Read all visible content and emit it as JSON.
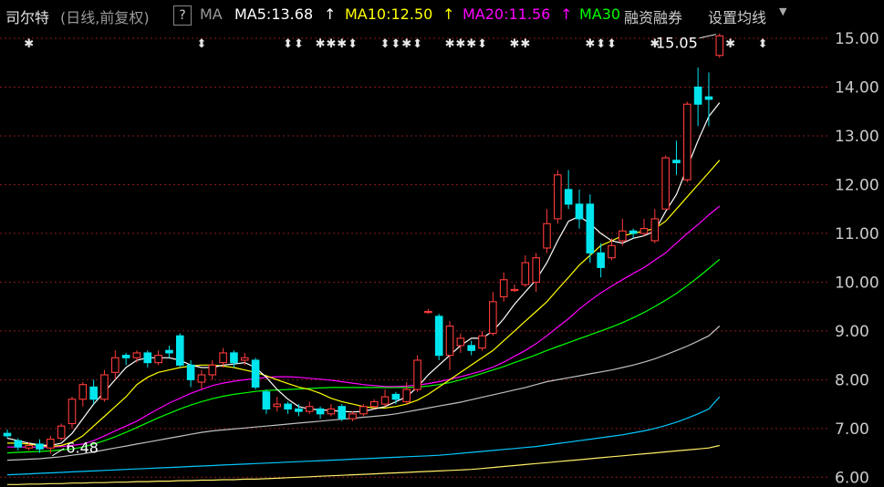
{
  "header": {
    "stock_name": "司尔特",
    "period": "(日线,前复权)",
    "help": "?",
    "ma_label": "MA",
    "ma5": "MA5:13.68",
    "ma10": "MA10:12.50",
    "ma20": "MA20:11.56",
    "ma30": "MA30",
    "up_arrow": "↑",
    "margin_trading": "融资融券",
    "settings": "设置均线",
    "dropdown_icon": "caret-down-icon"
  },
  "colors": {
    "up": "#ff3b3b",
    "down": "#00e5ee",
    "ma5": "#ffffff",
    "ma10": "#ffff00",
    "ma20": "#ff00ff",
    "ma30": "#00ff00",
    "ma60": "#c0c0c0",
    "ma120": "#00c8ff",
    "ma250": "#ffee66",
    "grid": "#8b1a1a",
    "text": "#cccccc"
  },
  "chart_data": {
    "type": "candlestick",
    "yaxis": {
      "ticks": [
        "6.00",
        "7.00",
        "8.00",
        "9.00",
        "10.00",
        "11.00",
        "12.00",
        "13.00",
        "14.00",
        "15.00"
      ],
      "ylim": [
        5.8,
        15.3
      ]
    },
    "annotations": {
      "low_label": "6.48",
      "high_label": "15.05"
    },
    "candles": [
      [
        6.9,
        6.85,
        6.98,
        6.8
      ],
      [
        6.75,
        6.62,
        6.8,
        6.55
      ],
      [
        6.6,
        6.65,
        6.72,
        6.55
      ],
      [
        6.68,
        6.58,
        6.78,
        6.5
      ],
      [
        6.6,
        6.78,
        6.85,
        6.48
      ],
      [
        6.8,
        7.05,
        7.1,
        6.75
      ],
      [
        7.1,
        7.6,
        7.65,
        7.0
      ],
      [
        7.6,
        7.9,
        7.95,
        7.45
      ],
      [
        7.85,
        7.6,
        8.0,
        7.5
      ],
      [
        7.6,
        8.1,
        8.2,
        7.55
      ],
      [
        8.15,
        8.45,
        8.6,
        8.0
      ],
      [
        8.5,
        8.45,
        8.55,
        8.3
      ],
      [
        8.45,
        8.55,
        8.6,
        8.35
      ],
      [
        8.55,
        8.35,
        8.6,
        8.25
      ],
      [
        8.35,
        8.5,
        8.6,
        8.3
      ],
      [
        8.6,
        8.55,
        8.7,
        8.45
      ],
      [
        8.9,
        8.3,
        8.95,
        8.25
      ],
      [
        8.3,
        8.0,
        8.4,
        7.85
      ],
      [
        7.95,
        8.1,
        8.2,
        7.8
      ],
      [
        8.1,
        8.3,
        8.4,
        8.0
      ],
      [
        8.35,
        8.55,
        8.65,
        8.25
      ],
      [
        8.55,
        8.35,
        8.6,
        8.25
      ],
      [
        8.4,
        8.45,
        8.55,
        8.3
      ],
      [
        8.4,
        7.85,
        8.45,
        7.8
      ],
      [
        7.75,
        7.4,
        7.8,
        7.3
      ],
      [
        7.45,
        7.5,
        7.65,
        7.35
      ],
      [
        7.5,
        7.4,
        7.55,
        7.3
      ],
      [
        7.4,
        7.35,
        7.5,
        7.25
      ],
      [
        7.35,
        7.45,
        7.55,
        7.3
      ],
      [
        7.4,
        7.3,
        7.45,
        7.2
      ],
      [
        7.3,
        7.4,
        7.5,
        7.25
      ],
      [
        7.45,
        7.2,
        7.5,
        7.15
      ],
      [
        7.2,
        7.3,
        7.35,
        7.15
      ],
      [
        7.3,
        7.45,
        7.5,
        7.25
      ],
      [
        7.45,
        7.55,
        7.6,
        7.4
      ],
      [
        7.5,
        7.65,
        7.8,
        7.45
      ],
      [
        7.7,
        7.6,
        7.75,
        7.5
      ],
      [
        7.55,
        7.8,
        7.95,
        7.5
      ],
      [
        7.8,
        8.4,
        8.5,
        7.75
      ],
      [
        9.4,
        9.4,
        9.45,
        9.35
      ],
      [
        9.3,
        8.5,
        9.35,
        8.4
      ],
      [
        8.5,
        9.1,
        9.2,
        8.2
      ],
      [
        8.7,
        8.85,
        8.95,
        8.55
      ],
      [
        8.7,
        8.6,
        8.8,
        8.5
      ],
      [
        8.65,
        8.9,
        9.0,
        8.6
      ],
      [
        8.95,
        9.6,
        9.8,
        8.9
      ],
      [
        9.7,
        10.05,
        10.2,
        9.6
      ],
      [
        9.85,
        9.85,
        9.95,
        9.8
      ],
      [
        9.95,
        10.4,
        10.55,
        9.9
      ],
      [
        10.0,
        10.5,
        10.6,
        9.8
      ],
      [
        10.7,
        11.2,
        11.5,
        10.6
      ],
      [
        11.3,
        12.2,
        12.3,
        11.2
      ],
      [
        11.9,
        11.6,
        12.3,
        11.5
      ],
      [
        11.6,
        11.3,
        11.9,
        11.1
      ],
      [
        11.6,
        10.6,
        11.8,
        10.4
      ],
      [
        10.6,
        10.3,
        10.8,
        10.1
      ],
      [
        10.5,
        10.75,
        10.9,
        10.45
      ],
      [
        10.85,
        11.05,
        11.3,
        10.75
      ],
      [
        11.05,
        11.0,
        11.1,
        10.9
      ],
      [
        11.0,
        11.1,
        11.3,
        10.95
      ],
      [
        10.85,
        11.3,
        11.5,
        10.8
      ],
      [
        11.5,
        12.55,
        12.6,
        11.5
      ],
      [
        12.5,
        12.45,
        12.9,
        12.2
      ],
      [
        12.1,
        13.65,
        13.7,
        12.05
      ],
      [
        14.0,
        13.65,
        14.4,
        13.2
      ],
      [
        13.8,
        13.75,
        14.3,
        13.2
      ],
      [
        14.65,
        15.05,
        15.1,
        14.6
      ]
    ],
    "ma": {
      "ma5": [
        6.8,
        6.75,
        6.7,
        6.66,
        6.65,
        6.7,
        6.9,
        7.2,
        7.5,
        7.75,
        8.0,
        8.25,
        8.4,
        8.45,
        8.45,
        8.45,
        8.4,
        8.3,
        8.25,
        8.25,
        8.3,
        8.32,
        8.35,
        8.25,
        8.05,
        7.8,
        7.6,
        7.45,
        7.4,
        7.38,
        7.37,
        7.35,
        7.34,
        7.35,
        7.4,
        7.45,
        7.55,
        7.65,
        7.85,
        8.1,
        8.3,
        8.5,
        8.7,
        8.85,
        8.85,
        9.0,
        9.25,
        9.55,
        9.8,
        10.05,
        10.4,
        10.85,
        11.25,
        11.35,
        11.2,
        11.0,
        10.85,
        10.8,
        10.9,
        10.95,
        11.05,
        11.45,
        11.8,
        12.35,
        12.9,
        13.4,
        13.68
      ],
      "ma10": [
        6.7,
        6.7,
        6.68,
        6.65,
        6.63,
        6.65,
        6.72,
        6.85,
        7.05,
        7.25,
        7.45,
        7.65,
        7.9,
        8.05,
        8.15,
        8.2,
        8.25,
        8.28,
        8.3,
        8.3,
        8.28,
        8.25,
        8.2,
        8.15,
        8.08,
        8.0,
        7.92,
        7.85,
        7.8,
        7.72,
        7.62,
        7.55,
        7.5,
        7.45,
        7.42,
        7.42,
        7.45,
        7.5,
        7.58,
        7.7,
        7.85,
        8.0,
        8.15,
        8.3,
        8.45,
        8.6,
        8.8,
        9.0,
        9.2,
        9.4,
        9.6,
        9.85,
        10.1,
        10.35,
        10.55,
        10.75,
        10.85,
        10.95,
        11.0,
        11.05,
        11.1,
        11.25,
        11.5,
        11.75,
        12.0,
        12.25,
        12.5
      ],
      "ma20": [
        6.62,
        6.62,
        6.62,
        6.62,
        6.62,
        6.63,
        6.65,
        6.68,
        6.75,
        6.85,
        6.95,
        7.05,
        7.15,
        7.28,
        7.4,
        7.52,
        7.62,
        7.72,
        7.8,
        7.88,
        7.93,
        7.97,
        8.0,
        8.02,
        8.05,
        8.06,
        8.06,
        8.05,
        8.03,
        8.01,
        7.99,
        7.96,
        7.93,
        7.9,
        7.88,
        7.86,
        7.86,
        7.87,
        7.89,
        7.92,
        7.96,
        8.01,
        8.06,
        8.12,
        8.18,
        8.26,
        8.36,
        8.48,
        8.6,
        8.74,
        8.9,
        9.08,
        9.25,
        9.45,
        9.62,
        9.78,
        9.92,
        10.05,
        10.18,
        10.3,
        10.45,
        10.6,
        10.8,
        11.0,
        11.18,
        11.38,
        11.56
      ],
      "ma30": [
        6.5,
        6.51,
        6.52,
        6.53,
        6.54,
        6.56,
        6.58,
        6.62,
        6.68,
        6.75,
        6.83,
        6.92,
        7.02,
        7.12,
        7.22,
        7.31,
        7.4,
        7.48,
        7.55,
        7.61,
        7.66,
        7.7,
        7.73,
        7.76,
        7.78,
        7.79,
        7.8,
        7.81,
        7.82,
        7.83,
        7.84,
        7.84,
        7.84,
        7.84,
        7.84,
        7.84,
        7.84,
        7.84,
        7.85,
        7.87,
        7.9,
        7.94,
        8.0,
        8.06,
        8.13,
        8.2,
        8.27,
        8.35,
        8.43,
        8.51,
        8.6,
        8.68,
        8.76,
        8.84,
        8.92,
        9.0,
        9.08,
        9.17,
        9.27,
        9.38,
        9.5,
        9.63,
        9.77,
        9.93,
        10.1,
        10.28,
        10.47
      ],
      "ma60": [
        6.35,
        6.36,
        6.37,
        6.38,
        6.4,
        6.42,
        6.45,
        6.48,
        6.52,
        6.56,
        6.6,
        6.64,
        6.68,
        6.72,
        6.76,
        6.8,
        6.84,
        6.88,
        6.92,
        6.95,
        6.97,
        6.99,
        7.01,
        7.03,
        7.05,
        7.07,
        7.09,
        7.11,
        7.13,
        7.15,
        7.17,
        7.19,
        7.21,
        7.23,
        7.25,
        7.27,
        7.3,
        7.34,
        7.38,
        7.42,
        7.46,
        7.5,
        7.54,
        7.59,
        7.64,
        7.69,
        7.74,
        7.79,
        7.84,
        7.9,
        7.96,
        8.0,
        8.04,
        8.08,
        8.12,
        8.16,
        8.2,
        8.25,
        8.3,
        8.36,
        8.43,
        8.51,
        8.6,
        8.69,
        8.79,
        8.9,
        9.1
      ],
      "ma120": [
        6.05,
        6.06,
        6.07,
        6.08,
        6.09,
        6.1,
        6.11,
        6.12,
        6.13,
        6.14,
        6.15,
        6.16,
        6.17,
        6.18,
        6.19,
        6.2,
        6.21,
        6.22,
        6.23,
        6.24,
        6.25,
        6.26,
        6.27,
        6.28,
        6.29,
        6.3,
        6.31,
        6.32,
        6.33,
        6.34,
        6.35,
        6.36,
        6.37,
        6.38,
        6.39,
        6.4,
        6.41,
        6.42,
        6.43,
        6.44,
        6.45,
        6.47,
        6.49,
        6.51,
        6.53,
        6.55,
        6.57,
        6.59,
        6.61,
        6.63,
        6.66,
        6.69,
        6.72,
        6.75,
        6.78,
        6.81,
        6.84,
        6.87,
        6.91,
        6.95,
        7.0,
        7.06,
        7.13,
        7.21,
        7.3,
        7.4,
        7.65
      ],
      "ma250": [
        5.85,
        5.85,
        5.86,
        5.86,
        5.87,
        5.87,
        5.88,
        5.88,
        5.89,
        5.89,
        5.9,
        5.9,
        5.91,
        5.91,
        5.92,
        5.92,
        5.93,
        5.93,
        5.94,
        5.94,
        5.95,
        5.95,
        5.96,
        5.96,
        5.97,
        5.98,
        5.99,
        6.0,
        6.01,
        6.02,
        6.03,
        6.04,
        6.05,
        6.06,
        6.07,
        6.08,
        6.09,
        6.1,
        6.11,
        6.12,
        6.13,
        6.14,
        6.15,
        6.16,
        6.18,
        6.2,
        6.22,
        6.24,
        6.26,
        6.28,
        6.3,
        6.32,
        6.34,
        6.36,
        6.38,
        6.4,
        6.42,
        6.44,
        6.46,
        6.48,
        6.5,
        6.52,
        6.54,
        6.56,
        6.58,
        6.6,
        6.65
      ]
    },
    "event_markers": [
      {
        "i": 2,
        "s": "✱"
      },
      {
        "i": 18,
        "s": "⬍"
      },
      {
        "i": 26,
        "s": "⬍"
      },
      {
        "i": 27,
        "s": "⬍"
      },
      {
        "i": 29,
        "s": "✱"
      },
      {
        "i": 30,
        "s": "✱"
      },
      {
        "i": 31,
        "s": "✱"
      },
      {
        "i": 32,
        "s": "⬍"
      },
      {
        "i": 35,
        "s": "⬍"
      },
      {
        "i": 36,
        "s": "⬍"
      },
      {
        "i": 37,
        "s": "✱"
      },
      {
        "i": 38,
        "s": "⬍"
      },
      {
        "i": 41,
        "s": "✱"
      },
      {
        "i": 42,
        "s": "✱"
      },
      {
        "i": 43,
        "s": "✱"
      },
      {
        "i": 44,
        "s": "⬍"
      },
      {
        "i": 47,
        "s": "✱"
      },
      {
        "i": 48,
        "s": "✱"
      },
      {
        "i": 54,
        "s": "✱"
      },
      {
        "i": 55,
        "s": "⬍"
      },
      {
        "i": 56,
        "s": "⬍"
      },
      {
        "i": 60,
        "s": "✱"
      },
      {
        "i": 67,
        "s": "✱"
      },
      {
        "i": 70,
        "s": "⬍"
      }
    ]
  }
}
